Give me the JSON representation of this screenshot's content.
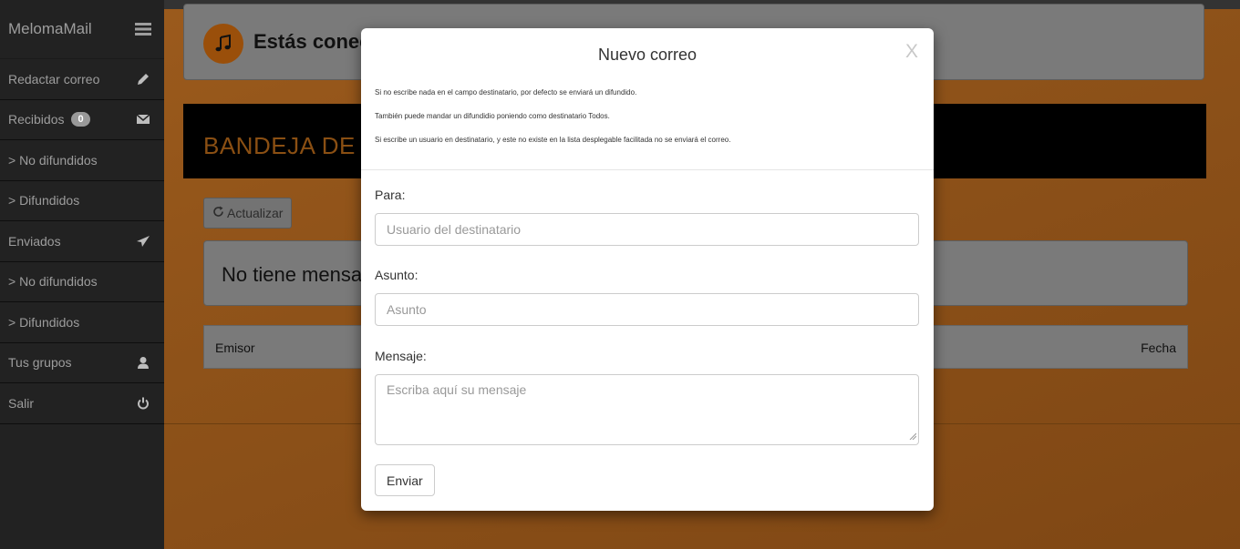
{
  "sidebar": {
    "brand": "MelomaMail",
    "items": [
      {
        "label": "Redactar correo",
        "icon": "pencil-icon"
      },
      {
        "label": "Recibidos",
        "badge": "0",
        "icon": "envelope-icon"
      },
      {
        "label": "> No difundidos"
      },
      {
        "label": "> Difundidos"
      },
      {
        "label": "Enviados",
        "icon": "send-icon"
      },
      {
        "label": "> No difundidos"
      },
      {
        "label": "> Difundidos"
      },
      {
        "label": "Tus grupos",
        "icon": "user-icon"
      },
      {
        "label": "Salir",
        "icon": "power-icon"
      }
    ]
  },
  "main": {
    "connected_text": "Estás conectado",
    "inbox_title": "BANDEJA DE ENTRADA",
    "refresh_label": "Actualizar",
    "no_messages": "No tiene mensajes",
    "columns": {
      "sender": "Emisor",
      "date": "Fecha"
    }
  },
  "modal": {
    "title": "Nuevo correo",
    "close": "X",
    "info": [
      "Si no escribe nada en el campo destinatario, por defecto se enviará un difundido.",
      "También puede mandar un difundidio poniendo como destinatario Todos.",
      "Si escribe un usuario en destinatario, y este no existe en la lista desplegable facilitada no se enviará el correo."
    ],
    "to_label": "Para:",
    "to_placeholder": "Usuario del destinatario",
    "subject_label": "Asunto:",
    "subject_placeholder": "Asunto",
    "message_label": "Mensaje:",
    "message_placeholder": "Escriba aquí su mensaje",
    "send_label": "Enviar"
  },
  "colors": {
    "sidebar_bg": "#222222",
    "sidebar_text": "#9d9d9d",
    "background": "#8e5219",
    "inbox_bar": "#000000",
    "accent": "#d9892b"
  }
}
